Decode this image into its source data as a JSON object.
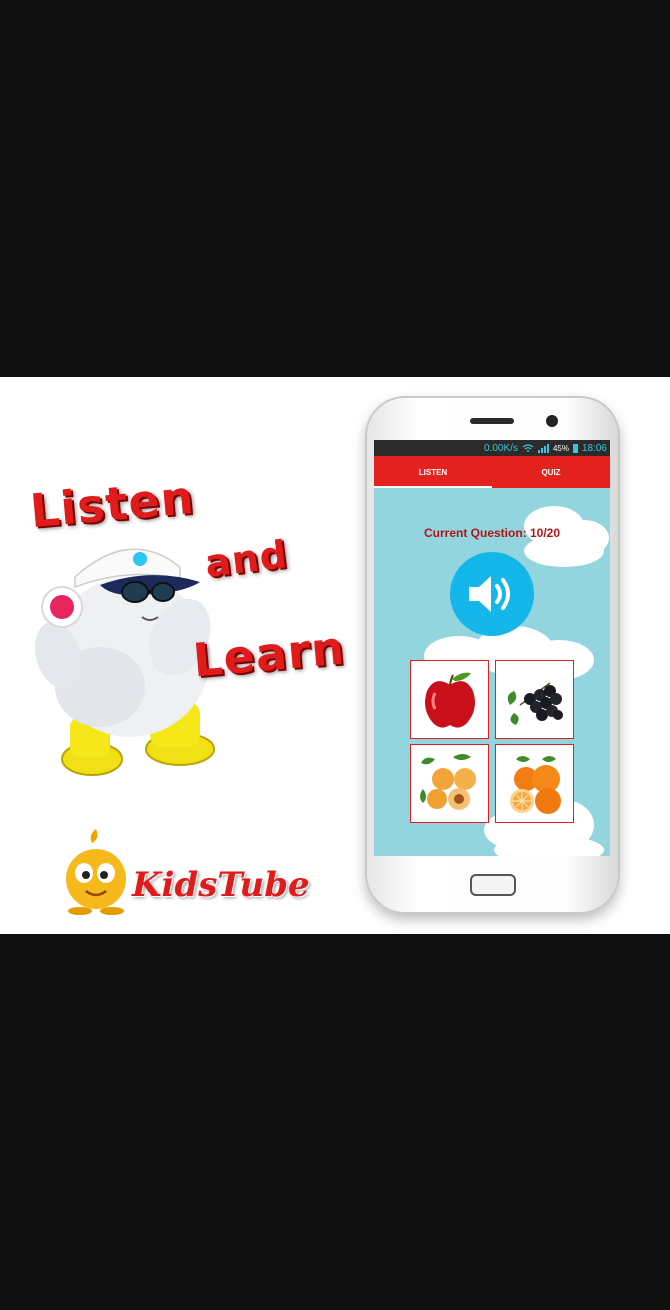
{
  "banner": {
    "headline": {
      "word1": "Listen",
      "word2": "and",
      "word3": "Learn"
    },
    "brand": "KidsTube"
  },
  "phone": {
    "status_bar": {
      "net_speed": "0.00K/s",
      "battery": "45%",
      "time": "18:06"
    },
    "tabs": [
      {
        "label": "LISTEN",
        "active": true
      },
      {
        "label": "QUIZ",
        "active": false
      }
    ],
    "question_label": "Current Question: 10/20",
    "play_icon": "speaker-volume-icon",
    "answers": [
      {
        "fruit": "apple"
      },
      {
        "fruit": "blackcurrant"
      },
      {
        "fruit": "apricot"
      },
      {
        "fruit": "orange"
      }
    ]
  },
  "colors": {
    "background": "#0f0f0f",
    "accent_red": "#e3211f",
    "screen_bg": "#93d5de",
    "speaker_button": "#15b6ea"
  }
}
